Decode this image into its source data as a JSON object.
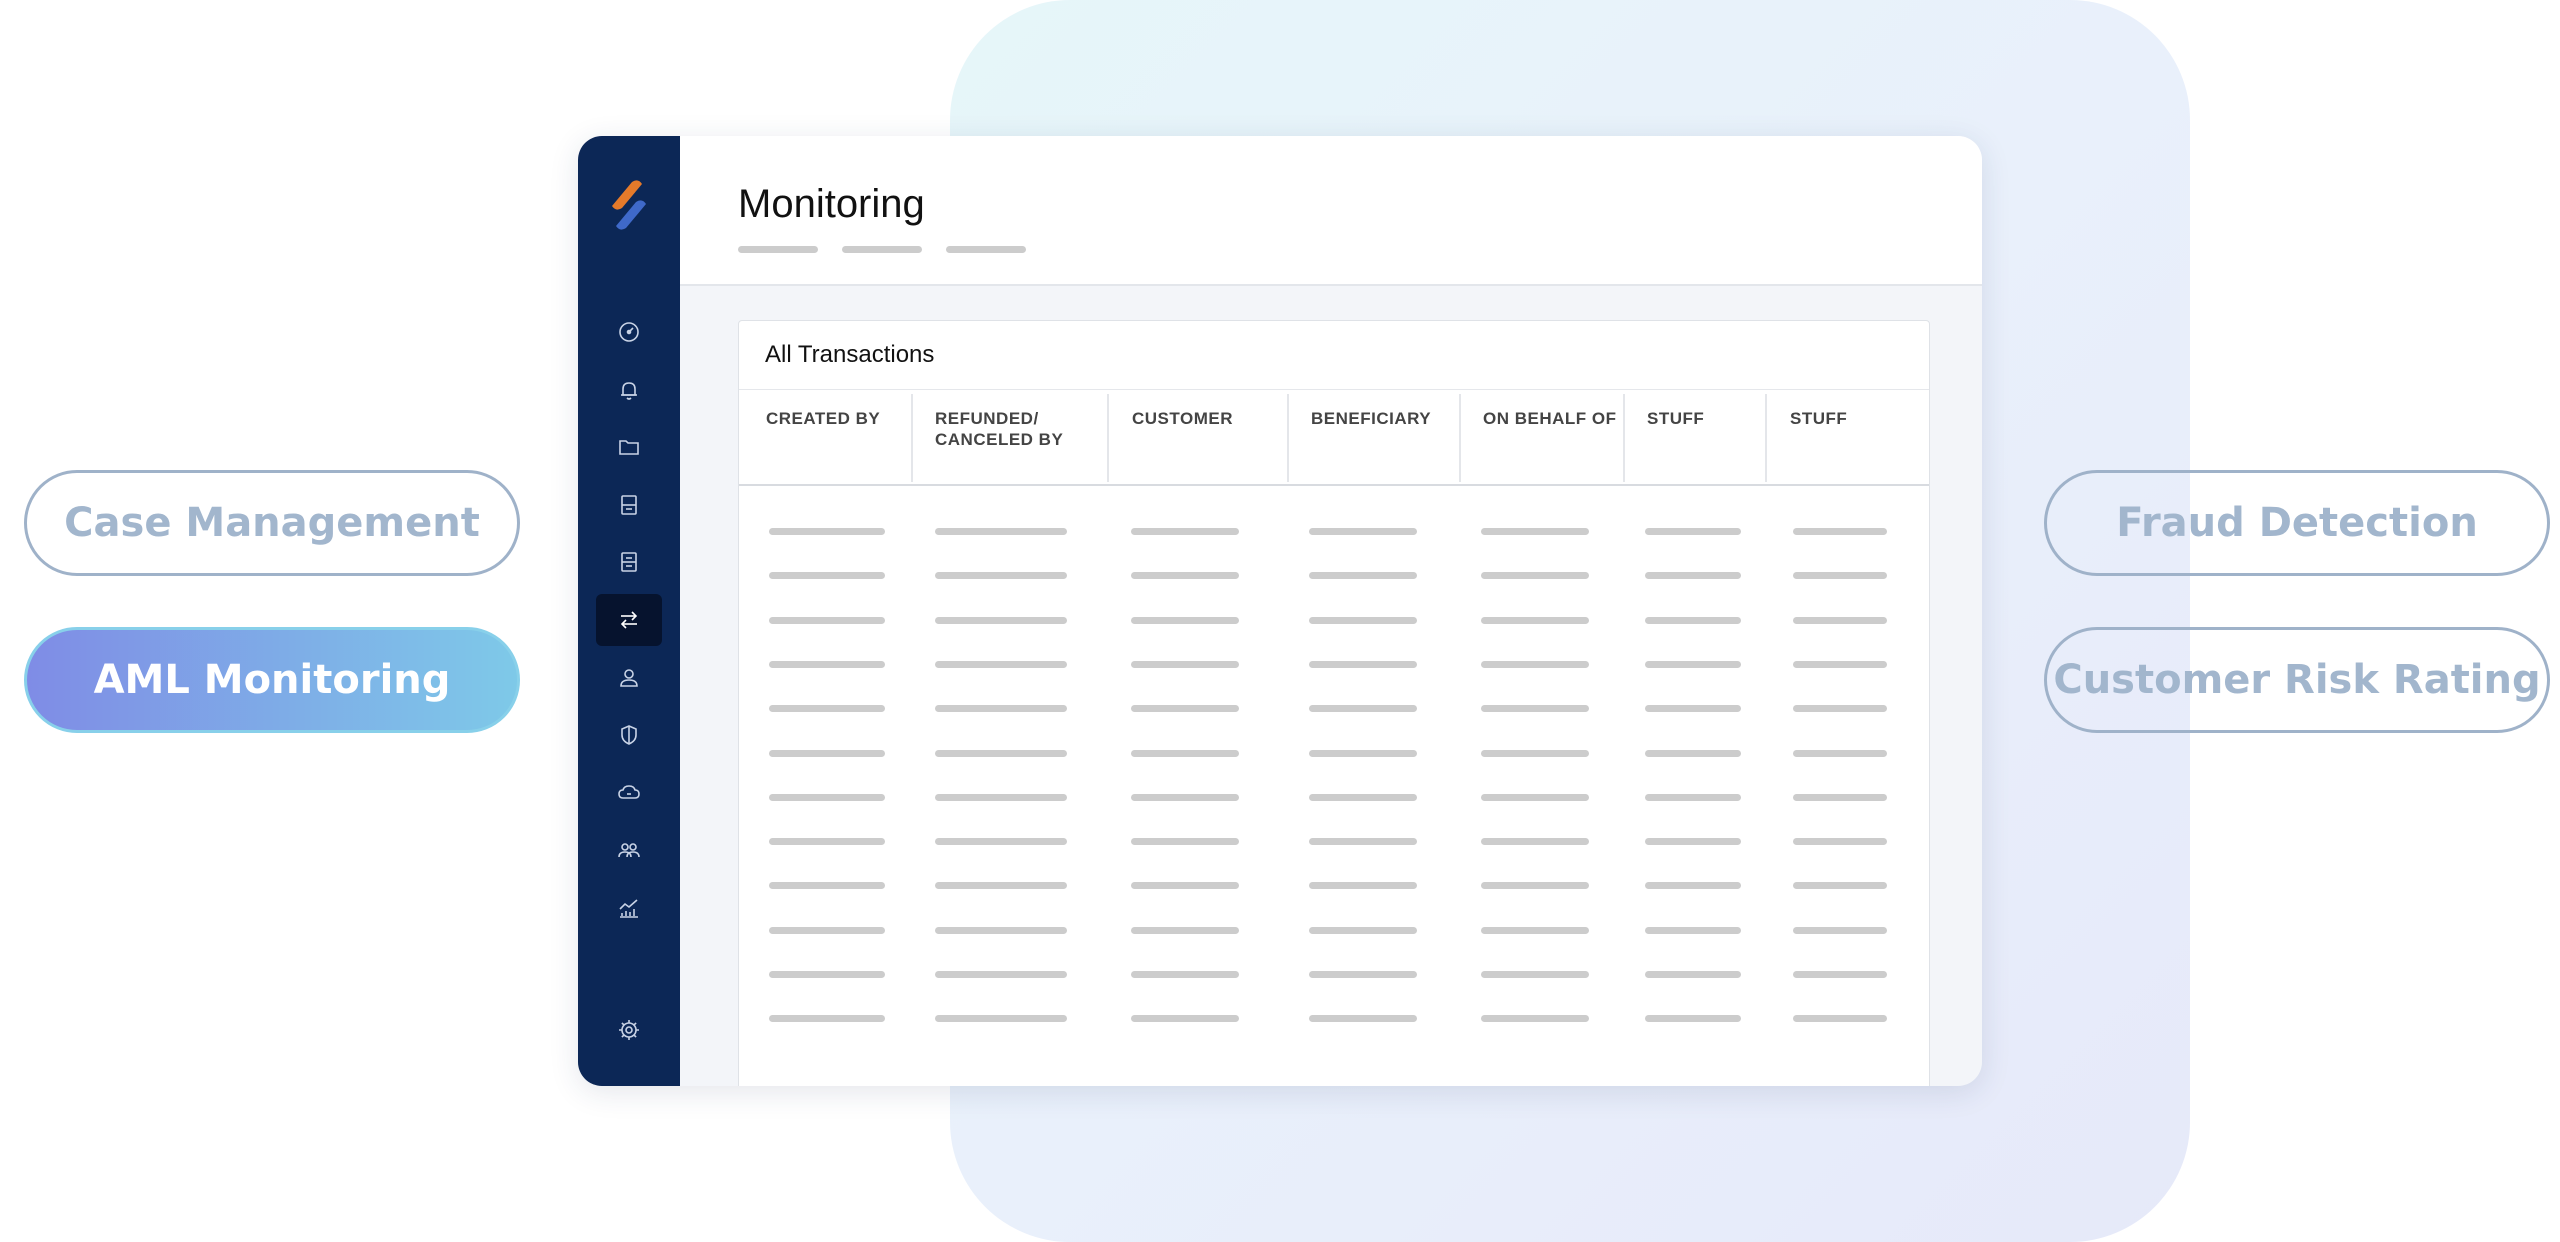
{
  "left_labels": [
    {
      "label": "Case Management",
      "active": false
    },
    {
      "label": "AML Monitoring",
      "active": true
    }
  ],
  "right_labels": [
    {
      "label": "Fraud Detection"
    },
    {
      "label": "Customer Risk Rating"
    }
  ],
  "app": {
    "title": "Monitoring",
    "sidebar": {
      "items": [
        {
          "icon": "dashboard-icon"
        },
        {
          "icon": "bell-icon"
        },
        {
          "icon": "folder-icon"
        },
        {
          "icon": "document-icon"
        },
        {
          "icon": "document-list-icon"
        },
        {
          "icon": "transfer-icon",
          "active": true
        },
        {
          "icon": "user-icon"
        },
        {
          "icon": "shield-icon"
        },
        {
          "icon": "cloud-icon"
        },
        {
          "icon": "users-icon"
        },
        {
          "icon": "analytics-icon"
        },
        {
          "icon": "gear-icon"
        }
      ]
    },
    "card": {
      "title": "All Transactions",
      "columns": [
        "CREATED BY",
        "REFUNDED/\nCANCELED BY",
        "CUSTOMER",
        "BENEFICIARY",
        "ON BEHALF OF",
        "STUFF",
        "STUFF"
      ]
    }
  },
  "colors": {
    "sidebar": "#0c2756",
    "sidebar_active": "#06132e",
    "pill_border": "#9fb2c9",
    "pill_text": "#a2b6cd",
    "accent_gradient_start": "#7f8ce6",
    "accent_gradient_end": "#7ec9e8",
    "skeleton": "#cccccc"
  }
}
